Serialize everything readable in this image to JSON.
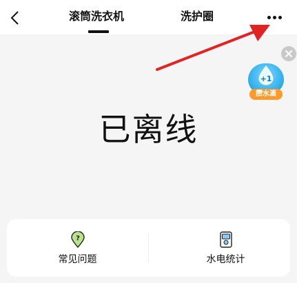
{
  "header": {
    "tabs": [
      {
        "label": "滚筒洗衣机",
        "active": true
      },
      {
        "label": "洗护圈",
        "active": false
      }
    ],
    "more_icon": "more-horizontal-icon",
    "back_icon": "chevron-left-icon"
  },
  "float_widget": {
    "badge": "+1",
    "label": "攒水滴",
    "close_icon": "close-icon",
    "drop_icon": "water-drop-icon"
  },
  "device": {
    "status": "已离线"
  },
  "bottom_card": {
    "items": [
      {
        "label": "常见问题",
        "icon": "help-pin-icon"
      },
      {
        "label": "水电统计",
        "icon": "stats-device-icon"
      }
    ]
  },
  "colors": {
    "annotation_arrow": "#e02424",
    "badge_orange": "#ff9a2b",
    "water_blue": "#39b4ee"
  }
}
